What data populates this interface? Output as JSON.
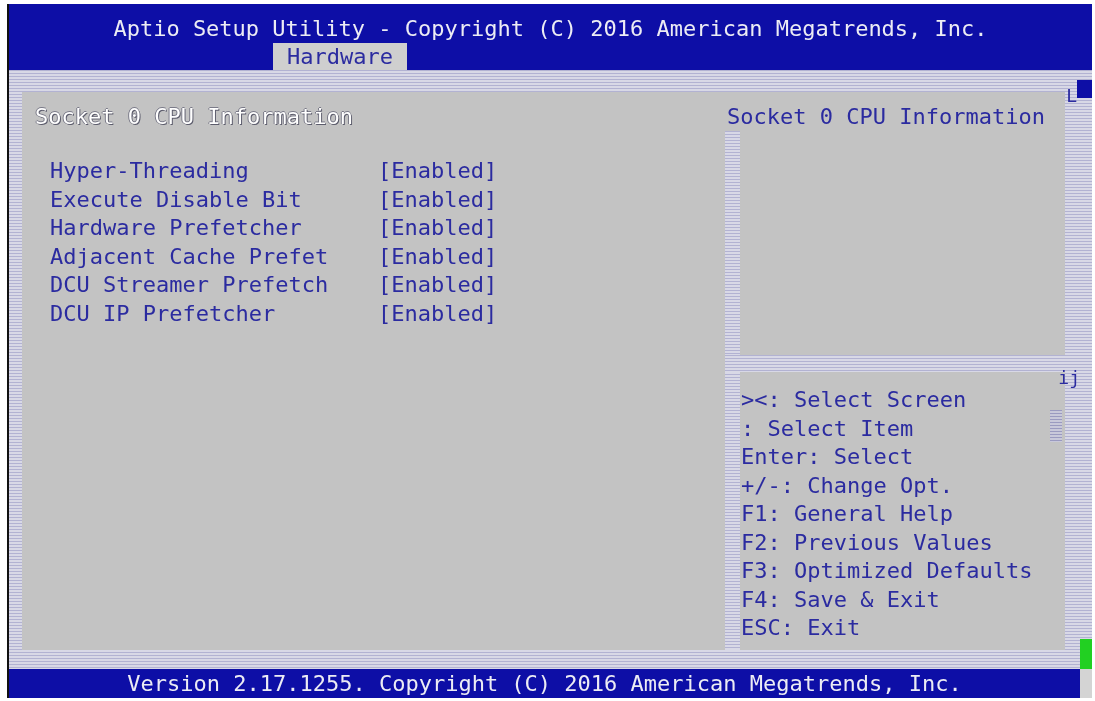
{
  "header": {
    "title": "Aptio Setup Utility - Copyright (C) 2016 American Megatrends, Inc.",
    "tabs": [
      {
        "label": "Hardware",
        "selected": true
      }
    ]
  },
  "settings_panel": {
    "heading": "Socket 0 CPU Information",
    "items": [
      {
        "label": "Hyper-Threading",
        "value": "[Enabled]"
      },
      {
        "label": "Execute Disable Bit",
        "value": "[Enabled]"
      },
      {
        "label": "Hardware Prefetcher",
        "value": "[Enabled]"
      },
      {
        "label": "Adjacent Cache Prefet",
        "value": "[Enabled]"
      },
      {
        "label": "DCU Streamer Prefetch",
        "value": "[Enabled]"
      },
      {
        "label": "DCU IP Prefetcher",
        "value": "[Enabled]"
      }
    ]
  },
  "help_panel": {
    "title": "Socket 0 CPU Information",
    "key_legend": [
      "><: Select Screen",
      ": Select Item",
      "Enter: Select",
      "+/-: Change Opt.",
      "F1: General Help",
      "F2: Previous Values",
      "F3: Optimized Defaults",
      "F4: Save & Exit",
      "ESC: Exit"
    ]
  },
  "border_glyphs": [
    "L",
    "ij"
  ],
  "footer": {
    "text": "Version 2.17.1255. Copyright (C) 2016 American Megatrends, Inc."
  }
}
